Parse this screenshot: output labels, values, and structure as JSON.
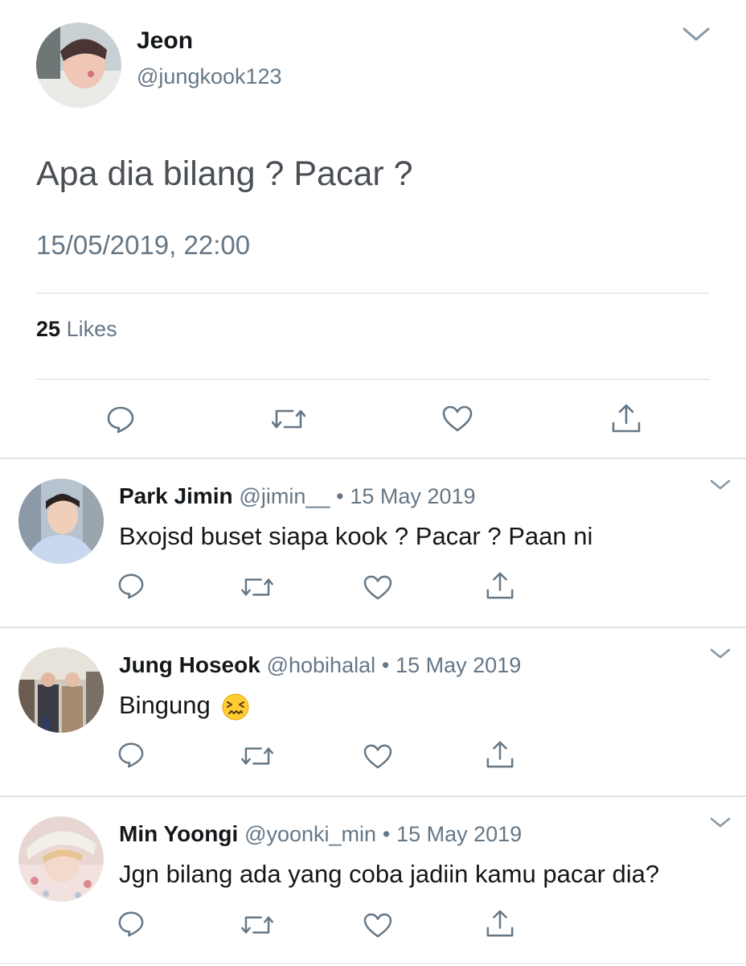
{
  "tweet": {
    "display_name": "Jeon",
    "handle": "@jungkook123",
    "text": "Apa dia bilang ? Pacar ?",
    "timestamp": "15/05/2019, 22:00",
    "likes_count": "25",
    "likes_label": "Likes"
  },
  "replies": [
    {
      "display_name": "Park Jimin",
      "handle": "@jimin__",
      "separator": "•",
      "date": "15 May 2019",
      "text": "Bxojsd buset siapa kook ? Pacar ? Paan ni"
    },
    {
      "display_name": "Jung Hoseok",
      "handle": "@hobihalal",
      "separator": "•",
      "date": "15 May 2019",
      "text": "Bingung",
      "emoji": "confounded-face"
    },
    {
      "display_name": "Min Yoongi",
      "handle": "@yoonki_min",
      "separator": "•",
      "date": "15 May 2019",
      "text": "Jgn bilang ada yang coba jadiin kamu pacar dia?"
    }
  ],
  "icons": [
    "chevron-down-icon",
    "reply-icon",
    "retweet-icon",
    "like-icon",
    "share-icon"
  ],
  "colors": {
    "text": "#14171a",
    "secondary": "#657786",
    "divider": "#d6dbe0",
    "icon": "#657786",
    "background": "#ffffff"
  }
}
